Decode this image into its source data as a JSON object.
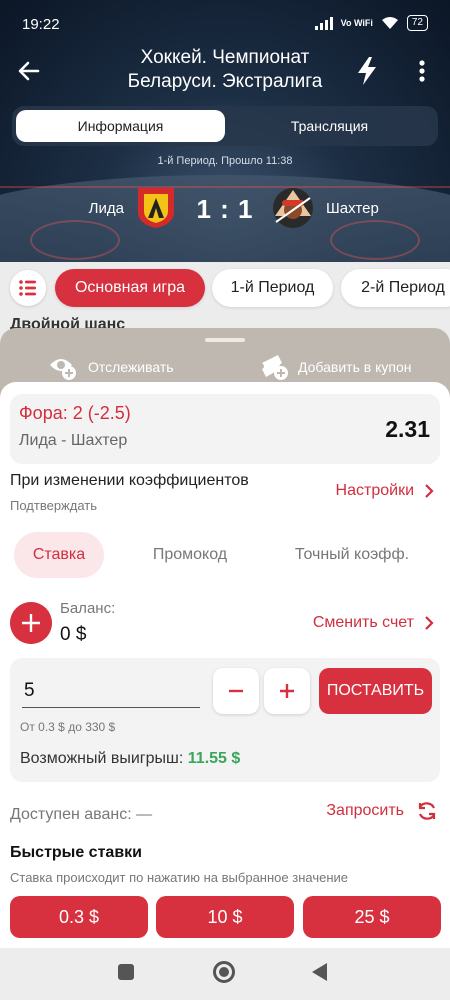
{
  "status_bar": {
    "time": "19:22",
    "network": "Vo WiFi",
    "battery": "72"
  },
  "header": {
    "title_line1": "Хоккей. Чемпионат",
    "title_line2": "Беларуси. Экстралига",
    "tabs": [
      "Информация",
      "Трансляция"
    ],
    "active_tab": "Информация",
    "period_status": "1-й Период. Прошло  11:38"
  },
  "match": {
    "team1": "Лида",
    "team2": "Шахтер",
    "score": "1 : 1"
  },
  "filters": {
    "chips": [
      "Основная игра",
      "1-й Период",
      "2-й Период"
    ],
    "active_chip": "Основная игра",
    "partial_section": "Двойной шанс"
  },
  "sheet": {
    "track_label": "Отслеживать",
    "add_coupon_label": "Добавить в купон",
    "bet": {
      "market": "Фора: 2 (-2.5)",
      "event": "Лида - Шахтер",
      "odds": "2.31"
    },
    "odds_change": {
      "title": "При изменении коэффициентов",
      "subtitle": "Подтверждать",
      "settings_label": "Настройки"
    },
    "tabs": [
      "Ставка",
      "Промокод",
      "Точный коэфф."
    ],
    "active_tab": "Ставка",
    "balance": {
      "label": "Баланс:",
      "value": "0 $",
      "change_account_label": "Сменить счет"
    },
    "stake": {
      "value": "5",
      "minus": "−",
      "plus": "+",
      "place_label": "ПОСТАВИТЬ",
      "range": "От 0.3 $ до 330 $",
      "win_label": "Возможный выигрыш:",
      "win_amount": "11.55 $"
    },
    "advance": {
      "label": "Доступен аванс: —",
      "request_label": "Запросить"
    },
    "quick_bets": {
      "title": "Быстрые ставки",
      "subtitle": "Ставка происходит по нажатию на выбранное значение",
      "amounts": [
        "0.3 $",
        "10 $",
        "25 $"
      ]
    }
  },
  "colors": {
    "accent": "#d7303f",
    "win_green": "#3aa55b",
    "header_dark": "#1d2f45"
  },
  "icons": {
    "back": "arrow-left-icon",
    "bolt": "lightning-bolt-icon",
    "more": "more-vertical-icon",
    "list": "list-icon",
    "track": "eye-plus-icon",
    "coupon": "ticket-plus-icon",
    "chevron": "chevron-right-icon",
    "refresh": "refresh-icon"
  }
}
